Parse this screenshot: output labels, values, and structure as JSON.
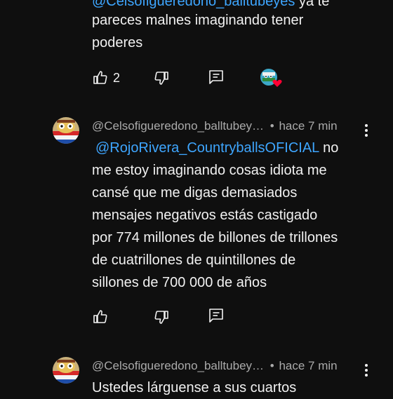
{
  "prev_comment": {
    "mention_cut": "@Celsofigueredono_balltubeyes",
    "text_cut": "ya te",
    "line2": "pareces malnes imaginando tener",
    "line3": "poderes",
    "like_count": "2",
    "icons": [
      "like-icon",
      "dislike-icon",
      "reply-icon",
      "creator-heart-icon"
    ]
  },
  "comments": [
    {
      "author": "@Celsofigueredono_balltubey…",
      "sep": "•",
      "time": "hace 7 min",
      "mention": "@RojoRivera_CountryballsOFICIAL",
      "lines": [
        "no",
        "me estoy imaginando cosas idiota me",
        "cansé que me digas demasiados",
        "mensajes negativos estás castigado",
        "por 774 millones de billones de trillones",
        "de cuatrillones de quintillones de",
        "sillones de 700 000 de años"
      ],
      "icons": [
        "like-icon",
        "dislike-icon",
        "reply-icon",
        "more-vert-icon"
      ]
    },
    {
      "author": "@Celsofigueredono_balltubey…",
      "sep": "•",
      "time": "hace 7 min",
      "lines": [
        "Ustedes lárguense a sus cuartos"
      ],
      "icons": [
        "more-vert-icon"
      ]
    }
  ],
  "colors": {
    "background": "#0f0f0f",
    "text": "#f1f1f1",
    "meta": "#aaaaaa",
    "mention": "#3ea6ff",
    "heart": "#ff0033"
  }
}
